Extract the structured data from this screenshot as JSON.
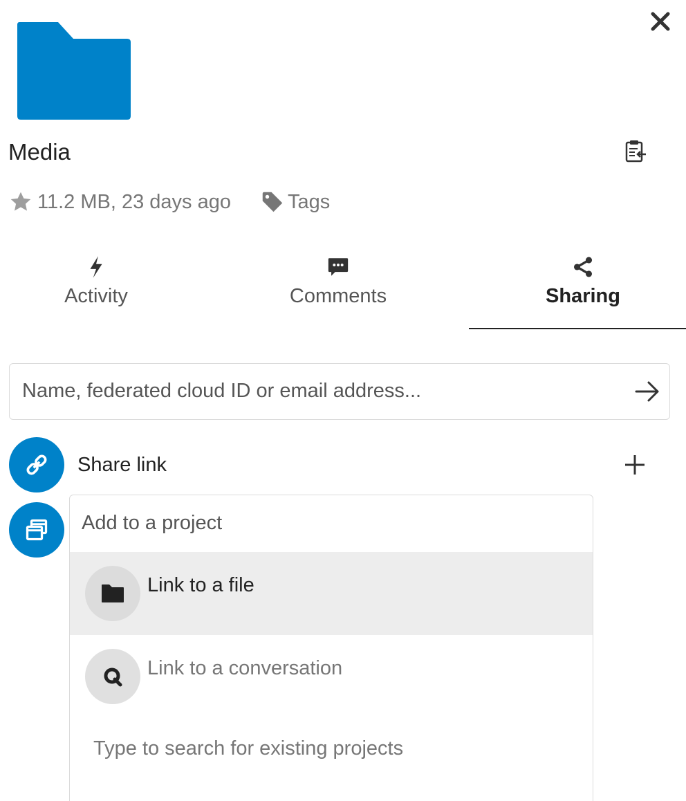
{
  "file": {
    "name": "Media",
    "size_time": "11.2 MB, 23 days ago",
    "tags_label": "Tags",
    "folder_color": "#0082c9"
  },
  "icons": {
    "close": "close-icon",
    "clipboard": "clipboard-icon",
    "star": "star-icon",
    "tag": "tag-icon"
  },
  "tabs": [
    {
      "label": "Activity",
      "icon": "lightning-icon",
      "active": false
    },
    {
      "label": "Comments",
      "icon": "comment-icon",
      "active": false
    },
    {
      "label": "Sharing",
      "icon": "share-icon",
      "active": true
    }
  ],
  "sharing": {
    "search_placeholder": "Name, federated cloud ID or email address...",
    "share_link_label": "Share link",
    "accent_color": "#0082c9"
  },
  "projects": {
    "placeholder": "Add to a project",
    "options": [
      {
        "label": "Link to a file",
        "icon": "folder-icon"
      },
      {
        "label": "Link to a conversation",
        "icon": "talk-icon"
      }
    ],
    "hint": "Type to search for existing projects"
  }
}
